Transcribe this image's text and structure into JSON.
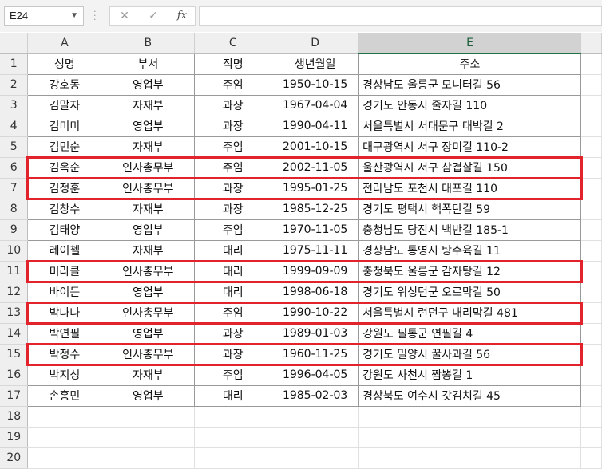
{
  "name_box": "E24",
  "formula_buttons": {
    "cancel": "✕",
    "enter": "✓",
    "fx": "fx"
  },
  "columns": [
    "A",
    "B",
    "C",
    "D",
    "E"
  ],
  "headers": {
    "name": "성명",
    "dept": "부서",
    "title": "직명",
    "birth": "생년월일",
    "addr": "주소"
  },
  "rows": [
    {
      "n": "2",
      "name": "강호동",
      "dept": "영업부",
      "title": "주임",
      "birth": "1950-10-15",
      "addr": "경상남도 울릉군 모니터길 56"
    },
    {
      "n": "3",
      "name": "김말자",
      "dept": "자재부",
      "title": "과장",
      "birth": "1967-04-04",
      "addr": "경기도 안동시 줄자길 110"
    },
    {
      "n": "4",
      "name": "김미미",
      "dept": "영업부",
      "title": "과장",
      "birth": "1990-04-11",
      "addr": "서울특별시 서대문구 대박길 2"
    },
    {
      "n": "5",
      "name": "김민순",
      "dept": "자재부",
      "title": "주임",
      "birth": "2001-10-15",
      "addr": "대구광역시 서구 장미길 110-2"
    },
    {
      "n": "6",
      "name": "김옥순",
      "dept": "인사총무부",
      "title": "주임",
      "birth": "2002-11-05",
      "addr": "울산광역시 서구 삼겹살길 150"
    },
    {
      "n": "7",
      "name": "김정훈",
      "dept": "인사총무부",
      "title": "과장",
      "birth": "1995-01-25",
      "addr": "전라남도 포천시 대포길 110"
    },
    {
      "n": "8",
      "name": "김창수",
      "dept": "자재부",
      "title": "과장",
      "birth": "1985-12-25",
      "addr": "경기도 평택시 핵폭탄길 59"
    },
    {
      "n": "9",
      "name": "김태양",
      "dept": "영업부",
      "title": "주임",
      "birth": "1970-11-05",
      "addr": "충청남도 당진시 백반길 185-1"
    },
    {
      "n": "10",
      "name": "레이첼",
      "dept": "자재부",
      "title": "대리",
      "birth": "1975-11-11",
      "addr": "경상남도 통영시 탕수육길 11"
    },
    {
      "n": "11",
      "name": "미라클",
      "dept": "인사총무부",
      "title": "대리",
      "birth": "1999-09-09",
      "addr": "충청북도 울릉군 감자탕길 12"
    },
    {
      "n": "12",
      "name": "바이든",
      "dept": "영업부",
      "title": "대리",
      "birth": "1998-06-18",
      "addr": "경기도 워싱턴군 오르막길 50"
    },
    {
      "n": "13",
      "name": "박나나",
      "dept": "인사총무부",
      "title": "주임",
      "birth": "1990-10-22",
      "addr": "서울특별시 런던구 내리막길 481"
    },
    {
      "n": "14",
      "name": "박연필",
      "dept": "영업부",
      "title": "과장",
      "birth": "1989-01-03",
      "addr": "강원도 필통군 연필길 4"
    },
    {
      "n": "15",
      "name": "박정수",
      "dept": "인사총무부",
      "title": "과장",
      "birth": "1960-11-25",
      "addr": "경기도 밀양시 꿀사과길 56"
    },
    {
      "n": "16",
      "name": "박지성",
      "dept": "자재부",
      "title": "주임",
      "birth": "1996-04-05",
      "addr": "강원도 사천시 짬뽕길 1"
    },
    {
      "n": "17",
      "name": "손흥민",
      "dept": "영업부",
      "title": "대리",
      "birth": "1985-02-03",
      "addr": "경상북도 여수시 갓김치길 45"
    }
  ],
  "empty_rows": [
    "18",
    "19",
    "20"
  ],
  "highlight_color": "#e3232b"
}
